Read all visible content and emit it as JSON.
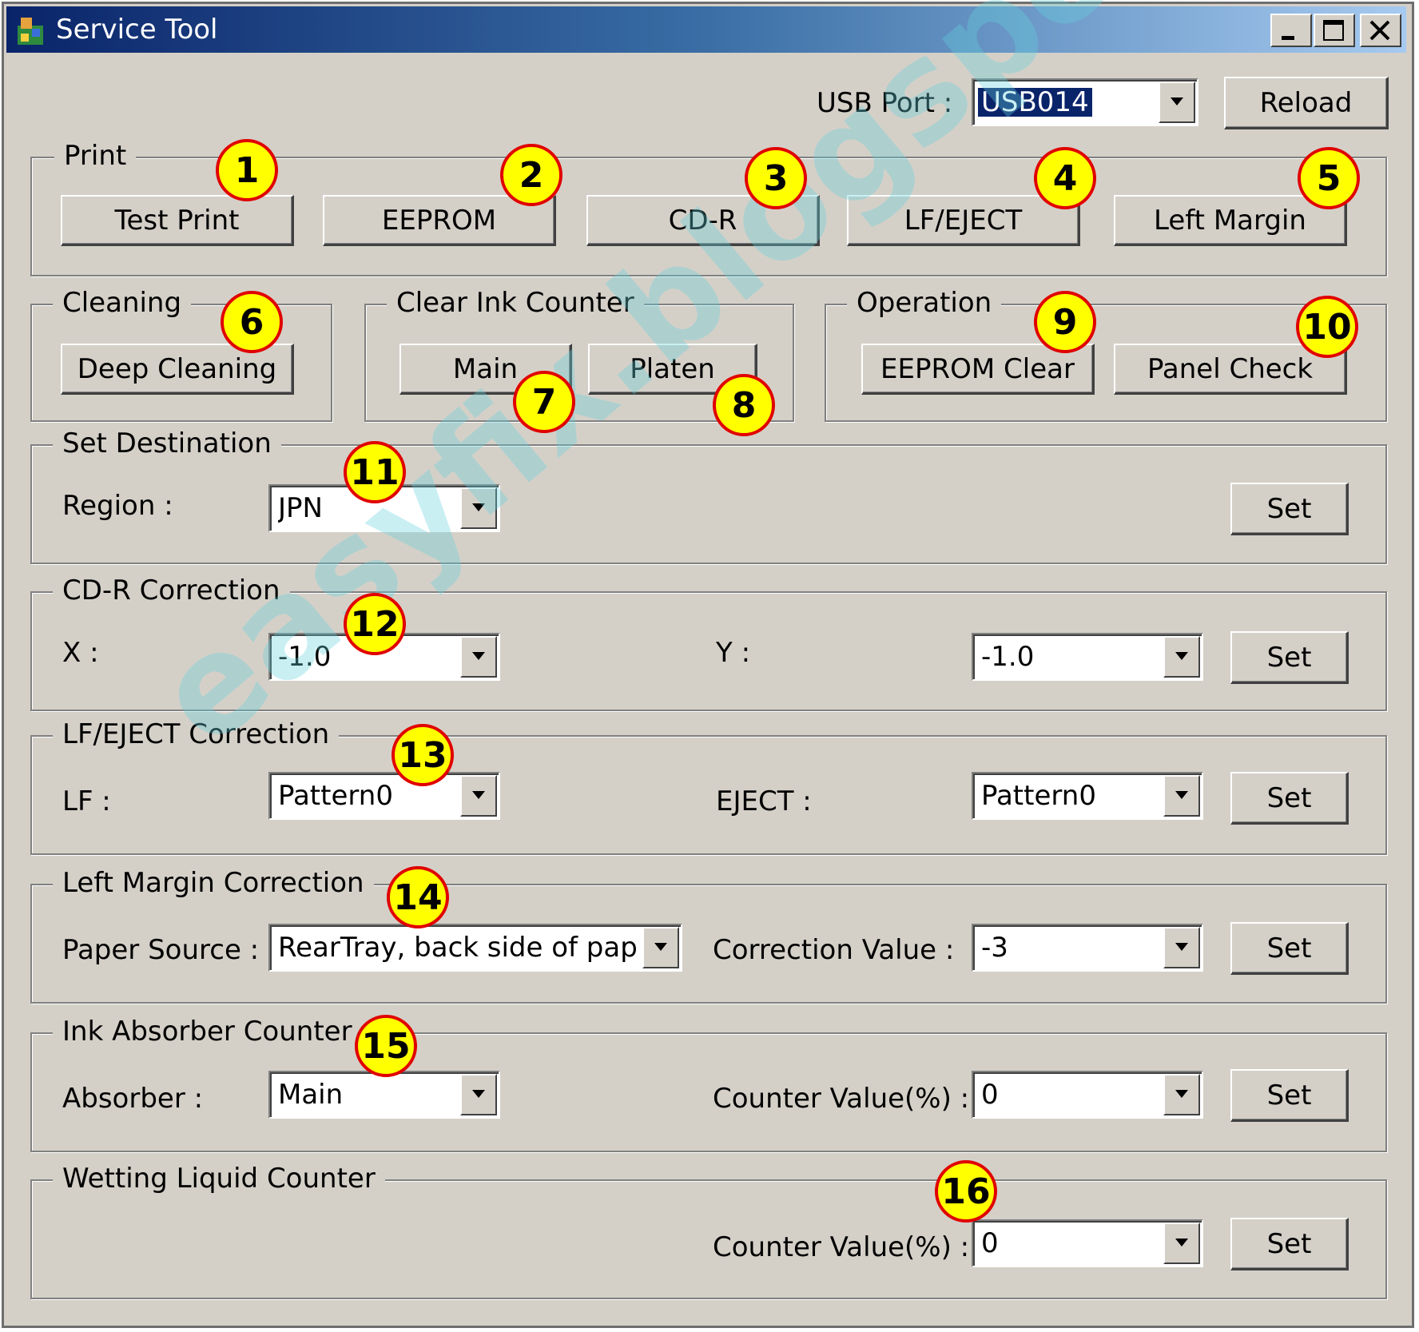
{
  "window": {
    "title": "Service Tool"
  },
  "usb": {
    "label": "USB Port :",
    "value": "USB014",
    "reload": "Reload"
  },
  "print": {
    "legend": "Print",
    "buttons": [
      "Test Print",
      "EEPROM",
      "CD-R",
      "LF/EJECT",
      "Left Margin"
    ]
  },
  "cleaning": {
    "legend": "Cleaning",
    "deep": "Deep Cleaning"
  },
  "clear_ink": {
    "legend": "Clear Ink Counter",
    "main": "Main",
    "platen": "Platen"
  },
  "operation": {
    "legend": "Operation",
    "eeprom_clear": "EEPROM Clear",
    "panel_check": "Panel Check"
  },
  "destination": {
    "legend": "Set Destination",
    "region_label": "Region :",
    "region_value": "JPN",
    "set": "Set"
  },
  "cdr": {
    "legend": "CD-R Correction",
    "x_label": "X :",
    "x_value": "-1.0",
    "y_label": "Y :",
    "y_value": "-1.0",
    "set": "Set"
  },
  "lf_eject": {
    "legend": "LF/EJECT Correction",
    "lf_label": "LF :",
    "lf_value": "Pattern0",
    "eject_label": "EJECT :",
    "eject_value": "Pattern0",
    "set": "Set"
  },
  "left_margin": {
    "legend": "Left Margin Correction",
    "source_label": "Paper Source :",
    "source_value": "RearTray, back side of pap",
    "corr_label": "Correction Value :",
    "corr_value": "-3",
    "set": "Set"
  },
  "ink_absorber": {
    "legend": "Ink Absorber Counter",
    "absorber_label": "Absorber :",
    "absorber_value": "Main",
    "counter_label": "Counter Value(%) :",
    "counter_value": "0",
    "set": "Set"
  },
  "wetting": {
    "legend": "Wetting Liquid Counter",
    "counter_label": "Counter Value(%) :",
    "counter_value": "0",
    "set": "Set"
  },
  "badges": [
    "1",
    "2",
    "3",
    "4",
    "5",
    "6",
    "7",
    "8",
    "9",
    "10",
    "11",
    "12",
    "13",
    "14",
    "15",
    "16"
  ],
  "watermark": "easyfix.blogspot.com",
  "colors": {
    "titlebar": "#0a246a",
    "face": "#d4d0c8",
    "badge_fill": "#ffff00",
    "badge_border": "#e00000"
  }
}
